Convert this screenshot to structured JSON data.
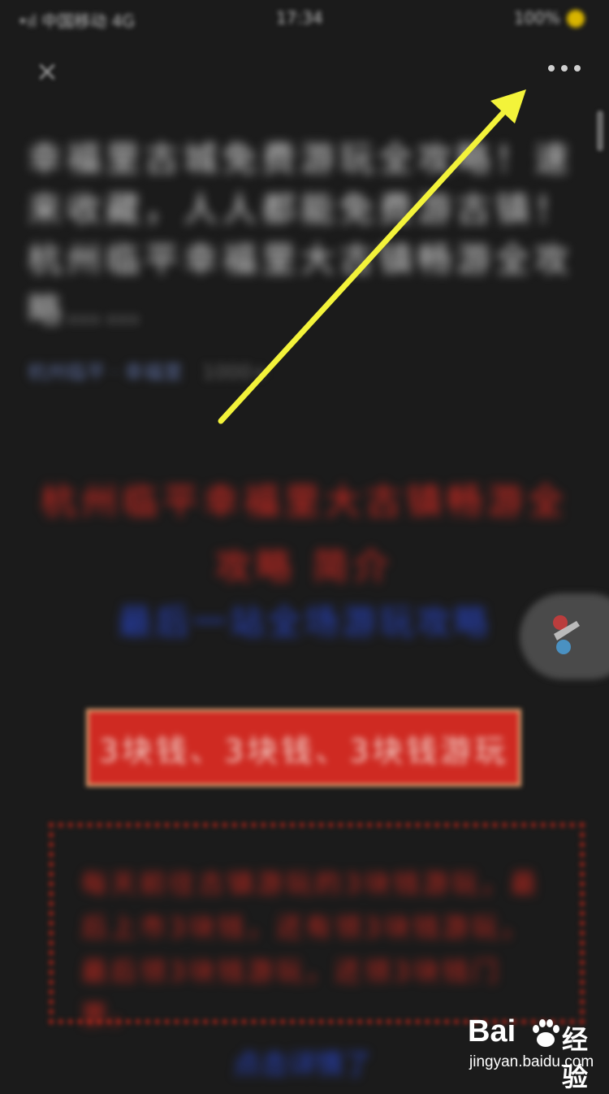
{
  "status_bar": {
    "carrier": "•ıl 中国移动 4G",
    "time": "17:34",
    "battery": "100%"
  },
  "nav": {
    "close_icon": "×"
  },
  "article": {
    "title": "幸福里古城免费游玩全攻略！速来收藏，人人都能免费游古镇！杭州临平幸福里大古镇畅游全攻略……",
    "meta_source": "杭州临平 · 幸福里",
    "meta_views": "1000+"
  },
  "content": {
    "red_heading": "杭州临平幸福里大古镇畅游全攻略 简介",
    "blue_subheading": "最后一站全场游玩攻略",
    "banner_text": "3块钱、3块钱、3块钱游玩",
    "notice_text": "每天前往古镇游玩的3块钱游玩，最后上市3块钱，还有领3块钱游玩，最后领3块钱游玩，还领3块钱门票。",
    "bottom_link": "点击详情了"
  },
  "watermark": {
    "brand": "Bai",
    "brand_cn": "经验",
    "url": "jingyan.baidu.com"
  },
  "colors": {
    "arrow": "#f3f33a",
    "accent_red": "#d62a22",
    "accent_blue": "#2845c8",
    "background": "#1b1b1b"
  }
}
